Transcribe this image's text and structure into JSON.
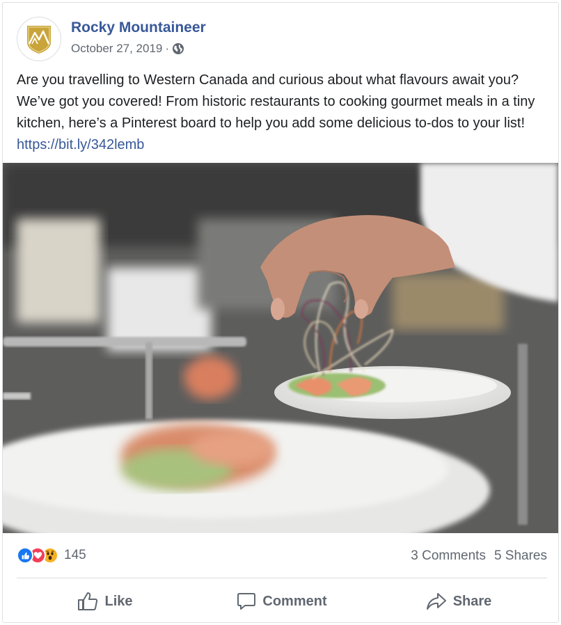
{
  "post": {
    "page_name": "Rocky Mountaineer",
    "date": "October 27, 2019",
    "separator": "·",
    "audience_icon": "globe-icon",
    "text": "Are you travelling to Western Canada and curious about what flavours await you? We’ve got you covered! From historic restaurants to cooking gourmet meals in a tiny kitchen, here’s a Pinterest board to help you add some delicious to-dos to your list! ",
    "link": "https://bit.ly/342lemb"
  },
  "stats": {
    "reaction_icons": [
      "like-reaction-icon",
      "love-reaction-icon",
      "wow-reaction-icon"
    ],
    "reaction_count": "145",
    "comments": "3 Comments",
    "shares": "5 Shares"
  },
  "actions": {
    "like": "Like",
    "comment": "Comment",
    "share": "Share"
  },
  "colors": {
    "link": "#385898",
    "muted": "#606770",
    "like_blue": "#1877f2",
    "love_red": "#f33e58",
    "wow_yellow": "#f7b125",
    "logo_gold": "#c9a43a"
  }
}
